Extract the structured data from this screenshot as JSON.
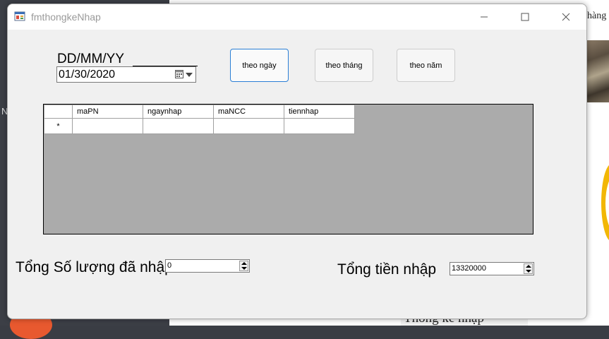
{
  "window": {
    "title": "fmthongkeNhap"
  },
  "background": {
    "left_char": "N",
    "right_top_text": "hàng",
    "right_bottom_text": "Thống kê nhập"
  },
  "date_section": {
    "format_label": "DD/MM/YY",
    "date_value": "01/30/2020"
  },
  "buttons": {
    "by_day": "theo ngày",
    "by_month": "theo tháng",
    "by_year": "theo năm"
  },
  "grid": {
    "columns": [
      "maPN",
      "ngaynhap",
      "maNCC",
      "tiennhap"
    ],
    "new_row_marker": "*"
  },
  "summary": {
    "qty_label": "Tổng Số lượng đã nhập",
    "qty_value": "0",
    "total_label": "Tổng tiền nhập",
    "total_value": "13320000"
  },
  "colors": {
    "accent_border": "#2b7fd6",
    "grid_background": "#ababab",
    "form_background": "#f0f0f0"
  }
}
